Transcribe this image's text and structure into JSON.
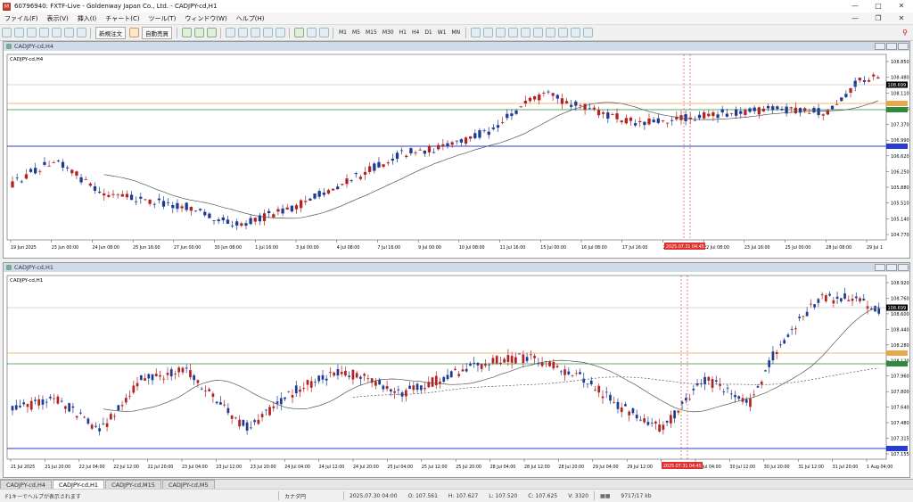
{
  "window": {
    "title": "60796940: FXTF-Live - Goldenway Japan Co., Ltd. - CADJPY-cd,H1"
  },
  "menu": [
    "ファイル(F)",
    "表示(V)",
    "挿入(I)",
    "チャート(C)",
    "ツール(T)",
    "ウィンドウ(W)",
    "ヘルプ(H)"
  ],
  "toolbar": {
    "new_order": "新規注文",
    "auto_trade": "自動売買",
    "timeframes": [
      "M1",
      "M5",
      "M15",
      "M30",
      "H1",
      "H4",
      "D1",
      "W1",
      "MN"
    ]
  },
  "chart_h4": {
    "window_title": "CADJPY-cd,H4",
    "label": "CADJPY-cd,H4",
    "price_labels": [
      "108.850",
      "108.480",
      "108.110",
      "107.740",
      "107.370",
      "106.990",
      "106.620",
      "106.250",
      "105.880",
      "105.510",
      "105.140",
      "104.770"
    ],
    "current_price": "108.699",
    "time_labels": [
      "19 Jun 2025",
      "23 Jun 00:00",
      "24 Jun 08:00",
      "25 Jun 16:00",
      "27 Jun 00:00",
      "30 Jun 08:00",
      "1 Jul 16:00",
      "3 Jul 00:00",
      "4 Jul 08:00",
      "7 Jul 16:00",
      "9 Jul 00:00",
      "10 Jul 08:00",
      "11 Jul 16:00",
      "15 Jul 00:00",
      "16 Jul 08:00",
      "17 Jul 16:00",
      "21 Jul 00:00",
      "22 Jul 08:00",
      "23 Jul 16:00",
      "25 Jul 00:00",
      "28 Jul 08:00",
      "29 Jul 1"
    ],
    "cursor_time": "2025.07.31 04:45"
  },
  "chart_h1": {
    "window_title": "CADJPY-cd,H1",
    "label": "CADJPY-cd,H1",
    "price_labels": [
      "108.920",
      "108.760",
      "108.600",
      "108.440",
      "108.280",
      "108.120",
      "107.960",
      "107.800",
      "107.640",
      "107.480",
      "107.315",
      "107.155"
    ],
    "current_price": "108.699",
    "time_labels": [
      "21 Jul 2025",
      "21 Jul 20:00",
      "22 Jul 04:00",
      "22 Jul 12:00",
      "22 Jul 20:00",
      "23 Jul 04:00",
      "23 Jul 12:00",
      "23 Jul 20:00",
      "24 Jul 04:00",
      "24 Jul 12:00",
      "24 Jul 20:00",
      "25 Jul 04:00",
      "25 Jul 12:00",
      "25 Jul 20:00",
      "28 Jul 04:00",
      "28 Jul 12:00",
      "28 Jul 20:00",
      "29 Jul 04:00",
      "29 Jul 12:00",
      "29 Jul 20:00",
      "30 Jul 04:00",
      "30 Jul 12:00",
      "30 Jul 20:00",
      "31 Jul 12:00",
      "31 Jul 20:00",
      "1 Aug 04:00"
    ],
    "cursor_time": "2025.07.31 04:45"
  },
  "tabs": [
    "CADJPY-cd,H4",
    "CADJPY-cd,H1",
    "CADJPY-cd,M15",
    "CADJPY-cd,M5"
  ],
  "status": {
    "help": "F1キーでヘルプが表示されます",
    "profile": "カナダ円",
    "datetime": "2025.07.30 04:00",
    "open": "O: 107.561",
    "high": "H: 107.627",
    "low": "L: 107.520",
    "close": "C: 107.625",
    "volume": "V: 3320",
    "traffic": "9717/17 kb"
  },
  "colors": {
    "bull": "#b22222",
    "bear": "#1f3a93",
    "ma": "#555555",
    "resistance": "#e8a84a",
    "support_green": "#2e8b3e",
    "support_blue": "#2a3bd0",
    "cursor": "#e03030"
  }
}
